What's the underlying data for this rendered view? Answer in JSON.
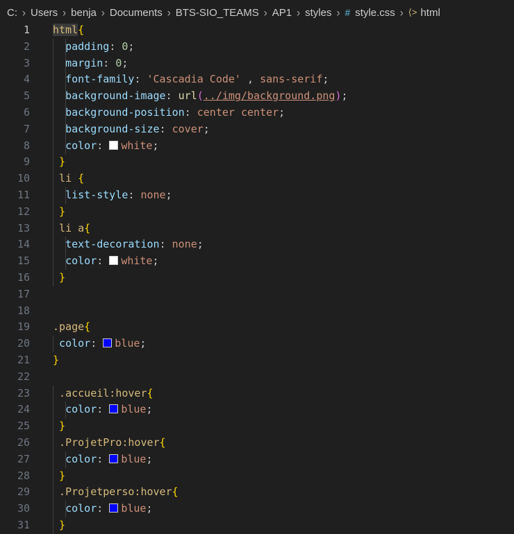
{
  "breadcrumb": {
    "items": [
      "C:",
      "Users",
      "benja",
      "Documents",
      "BTS-SIO_TEAMS",
      "AP1",
      "styles"
    ],
    "file": "style.css",
    "symbol": "html"
  },
  "colors": {
    "white_swatch": "#ffffff",
    "blue_swatch": "#0000ff"
  },
  "icons": {
    "file": "css-file-icon",
    "symbol": "symbol-icon"
  },
  "lines": [
    {
      "n": "1",
      "selector": "html",
      "open": "{"
    },
    {
      "n": "2",
      "prop": "padding",
      "val": "0"
    },
    {
      "n": "3",
      "prop": "margin",
      "val": "0"
    },
    {
      "n": "4",
      "prop": "font-family",
      "val1": "'Cascadia Code'",
      "val2": "sans-serif"
    },
    {
      "n": "5",
      "prop": "background-image",
      "fn": "url",
      "url": "../img/background.png"
    },
    {
      "n": "6",
      "prop": "background-position",
      "val": "center center"
    },
    {
      "n": "7",
      "prop": "background-size",
      "val": "cover"
    },
    {
      "n": "8",
      "prop": "color",
      "val": "white"
    },
    {
      "n": "9",
      "close": "}"
    },
    {
      "n": "10",
      "selector": "li ",
      "open": "{"
    },
    {
      "n": "11",
      "prop": "list-style",
      "val": "none"
    },
    {
      "n": "12",
      "close": "}"
    },
    {
      "n": "13",
      "selector": "li a",
      "open": "{"
    },
    {
      "n": "14",
      "prop": "text-decoration",
      "val": "none"
    },
    {
      "n": "15",
      "prop": "color",
      "val": "white"
    },
    {
      "n": "16",
      "close": "}"
    },
    {
      "n": "17"
    },
    {
      "n": "18"
    },
    {
      "n": "19",
      "selector": ".page",
      "open": "{"
    },
    {
      "n": "20",
      "prop": "color",
      "val": "blue"
    },
    {
      "n": "21",
      "close": "}"
    },
    {
      "n": "22"
    },
    {
      "n": "23",
      "selector": ".accueil:hover",
      "open": "{"
    },
    {
      "n": "24",
      "prop": "color",
      "val": "blue"
    },
    {
      "n": "25",
      "close": "}"
    },
    {
      "n": "26",
      "selector": ".ProjetPro:hover",
      "open": "{"
    },
    {
      "n": "27",
      "prop": "color",
      "val": "blue"
    },
    {
      "n": "28",
      "close": "}"
    },
    {
      "n": "29",
      "selector": ".Projetperso:hover",
      "open": "{"
    },
    {
      "n": "30",
      "prop": "color",
      "val": "blue"
    },
    {
      "n": "31",
      "close": "}"
    }
  ]
}
